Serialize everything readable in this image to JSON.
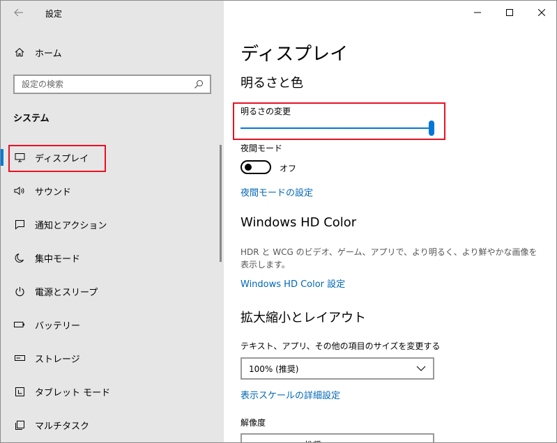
{
  "window": {
    "title": "設定"
  },
  "sidebar": {
    "home_label": "ホーム",
    "search_placeholder": "設定の検索",
    "section_title": "システム",
    "items": [
      {
        "label": "ディスプレイ",
        "icon": "monitor-icon",
        "active": true
      },
      {
        "label": "サウンド",
        "icon": "speaker-icon"
      },
      {
        "label": "通知とアクション",
        "icon": "notification-icon"
      },
      {
        "label": "集中モード",
        "icon": "moon-icon"
      },
      {
        "label": "電源とスリープ",
        "icon": "power-icon"
      },
      {
        "label": "バッテリー",
        "icon": "battery-icon"
      },
      {
        "label": "ストレージ",
        "icon": "storage-icon"
      },
      {
        "label": "タブレット モード",
        "icon": "tablet-icon"
      },
      {
        "label": "マルチタスク",
        "icon": "multitask-icon"
      }
    ]
  },
  "main": {
    "page_title": "ディスプレイ",
    "brightness_section": "明るさと色",
    "brightness_label": "明るさの変更",
    "brightness_value": 1.0,
    "night_light_label": "夜間モード",
    "night_light_state": "オフ",
    "night_light_link": "夜間モードの設定",
    "hd_color_title": "Windows HD Color",
    "hd_color_desc": "HDR と WCG のビデオ、ゲーム、アプリで、より明るく、より鮮やかな画像を表示します。",
    "hd_color_link": "Windows HD Color 設定",
    "scale_section": "拡大縮小とレイアウト",
    "scale_label": "テキスト、アプリ、その他の項目のサイズを変更する",
    "scale_value": "100% (推奨)",
    "scale_link": "表示スケールの詳細設定",
    "resolution_label": "解像度",
    "resolution_value_partial": "推奨"
  },
  "colors": {
    "accent": "#0078d7",
    "link": "#0067b8",
    "highlight": "#e81123",
    "sidebar_bg": "#e6e6e6"
  }
}
